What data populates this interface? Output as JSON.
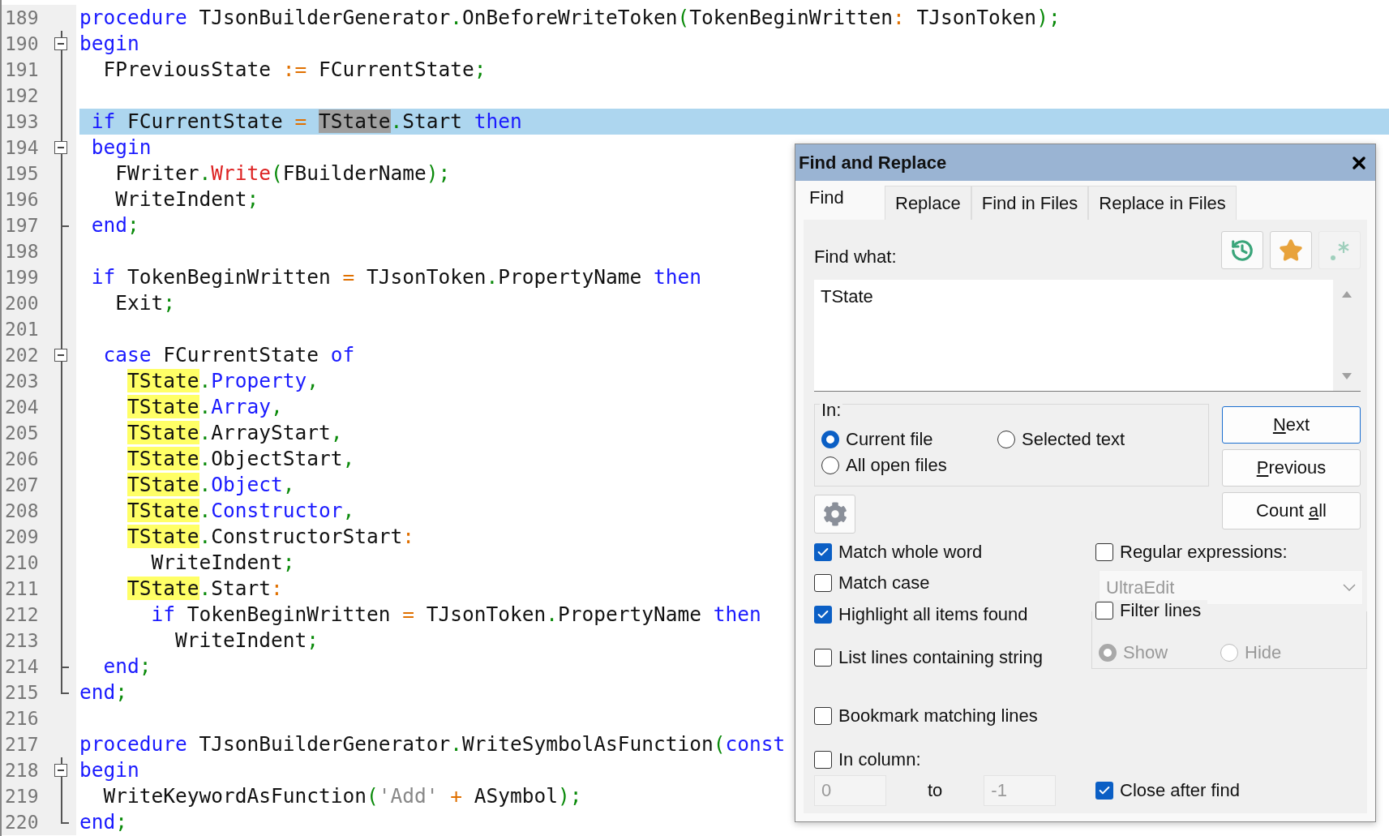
{
  "editor": {
    "lines": [
      {
        "number": "189",
        "kind": "none",
        "current": false,
        "tokens": [
          {
            "kind": "kw",
            "text": "procedure"
          },
          {
            "kind": "id",
            "text": " TJsonBuilderGenerator"
          },
          {
            "kind": "punct",
            "text": "."
          },
          {
            "kind": "id",
            "text": "OnBeforeWriteToken"
          },
          {
            "kind": "punct",
            "text": "("
          },
          {
            "kind": "id",
            "text": "TokenBeginWritten"
          },
          {
            "kind": "op",
            "text": ":"
          },
          {
            "kind": "id",
            "text": " TJsonToken"
          },
          {
            "kind": "punct",
            "text": ");"
          }
        ]
      },
      {
        "number": "190",
        "kind": "collapse",
        "current": false,
        "tokens": [
          {
            "kind": "kw",
            "text": "begin"
          }
        ]
      },
      {
        "number": "191",
        "kind": "line",
        "current": false,
        "tokens": [
          {
            "kind": "id",
            "text": "  FPreviousState "
          },
          {
            "kind": "op",
            "text": ":="
          },
          {
            "kind": "id",
            "text": " FCurrentState"
          },
          {
            "kind": "punct",
            "text": ";"
          }
        ]
      },
      {
        "number": "192",
        "kind": "line",
        "current": false
      },
      {
        "number": "193",
        "kind": "line",
        "current": true,
        "tokens": [
          {
            "kind": "kw",
            "text": " if"
          },
          {
            "kind": "id",
            "text": " FCurrentState "
          },
          {
            "kind": "op",
            "text": "="
          },
          {
            "kind": "selected",
            "text": " TState"
          },
          {
            "kind": "punct",
            "text": "."
          },
          {
            "kind": "id",
            "text": "Start "
          },
          {
            "kind": "kw",
            "text": "then"
          }
        ]
      },
      {
        "number": "194",
        "kind": "collapse",
        "current": false,
        "tokens": [
          {
            "kind": "kw",
            "text": " begin"
          }
        ]
      },
      {
        "number": "195",
        "kind": "line",
        "current": false,
        "tokens": [
          {
            "kind": "id",
            "text": "   FWriter"
          },
          {
            "kind": "punct",
            "text": "."
          },
          {
            "kind": "method",
            "text": "Write"
          },
          {
            "kind": "punct",
            "text": "("
          },
          {
            "kind": "id",
            "text": "FBuilderName"
          },
          {
            "kind": "punct",
            "text": ");"
          }
        ]
      },
      {
        "number": "196",
        "kind": "line",
        "current": false,
        "tokens": [
          {
            "kind": "id",
            "text": "   WriteIndent"
          },
          {
            "kind": "punct",
            "text": ";"
          }
        ]
      },
      {
        "number": "197",
        "kind": "branch",
        "current": false,
        "tokens": [
          {
            "kind": "kw",
            "text": " end"
          },
          {
            "kind": "punct",
            "text": ";"
          }
        ]
      },
      {
        "number": "198",
        "kind": "line",
        "current": false
      },
      {
        "number": "199",
        "kind": "line",
        "current": false,
        "tokens": [
          {
            "kind": "kw",
            "text": " if"
          },
          {
            "kind": "id",
            "text": " TokenBeginWritten "
          },
          {
            "kind": "op",
            "text": "="
          },
          {
            "kind": "id",
            "text": " TJsonToken"
          },
          {
            "kind": "punct",
            "text": "."
          },
          {
            "kind": "id",
            "text": "PropertyName "
          },
          {
            "kind": "kw",
            "text": "then"
          }
        ]
      },
      {
        "number": "200",
        "kind": "line",
        "current": false,
        "tokens": [
          {
            "kind": "id",
            "text": "   Exit"
          },
          {
            "kind": "punct",
            "text": ";"
          }
        ]
      },
      {
        "number": "201",
        "kind": "line",
        "current": false
      },
      {
        "number": "202",
        "kind": "collapse",
        "current": false,
        "tokens": [
          {
            "kind": "kw",
            "text": "  case"
          },
          {
            "kind": "id",
            "text": " FCurrentState "
          },
          {
            "kind": "kw",
            "text": "of"
          }
        ]
      },
      {
        "number": "203",
        "kind": "line",
        "current": false,
        "tokens": [
          {
            "kind": "match",
            "text": "    TState"
          },
          {
            "kind": "punct",
            "text": "."
          },
          {
            "kind": "kw",
            "text": "Property"
          },
          {
            "kind": "punct",
            "text": ","
          }
        ]
      },
      {
        "number": "204",
        "kind": "line",
        "current": false,
        "tokens": [
          {
            "kind": "match",
            "text": "    TState"
          },
          {
            "kind": "punct",
            "text": "."
          },
          {
            "kind": "kw",
            "text": "Array"
          },
          {
            "kind": "punct",
            "text": ","
          }
        ]
      },
      {
        "number": "205",
        "kind": "line",
        "current": false,
        "tokens": [
          {
            "kind": "match",
            "text": "    TState"
          },
          {
            "kind": "punct",
            "text": "."
          },
          {
            "kind": "id",
            "text": "ArrayStart"
          },
          {
            "kind": "punct",
            "text": ","
          }
        ]
      },
      {
        "number": "206",
        "kind": "line",
        "current": false,
        "tokens": [
          {
            "kind": "match",
            "text": "    TState"
          },
          {
            "kind": "punct",
            "text": "."
          },
          {
            "kind": "id",
            "text": "ObjectStart"
          },
          {
            "kind": "punct",
            "text": ","
          }
        ]
      },
      {
        "number": "207",
        "kind": "line",
        "current": false,
        "tokens": [
          {
            "kind": "match",
            "text": "    TState"
          },
          {
            "kind": "punct",
            "text": "."
          },
          {
            "kind": "kw",
            "text": "Object"
          },
          {
            "kind": "punct",
            "text": ","
          }
        ]
      },
      {
        "number": "208",
        "kind": "line",
        "current": false,
        "tokens": [
          {
            "kind": "match",
            "text": "    TState"
          },
          {
            "kind": "punct",
            "text": "."
          },
          {
            "kind": "kw",
            "text": "Constructor"
          },
          {
            "kind": "punct",
            "text": ","
          }
        ]
      },
      {
        "number": "209",
        "kind": "line",
        "current": false,
        "tokens": [
          {
            "kind": "match",
            "text": "    TState"
          },
          {
            "kind": "punct",
            "text": "."
          },
          {
            "kind": "id",
            "text": "ConstructorStart"
          },
          {
            "kind": "op",
            "text": ":"
          }
        ]
      },
      {
        "number": "210",
        "kind": "line",
        "current": false,
        "tokens": [
          {
            "kind": "id",
            "text": "      WriteIndent"
          },
          {
            "kind": "punct",
            "text": ";"
          }
        ]
      },
      {
        "number": "211",
        "kind": "line",
        "current": false,
        "tokens": [
          {
            "kind": "match",
            "text": "    TState"
          },
          {
            "kind": "punct",
            "text": "."
          },
          {
            "kind": "id",
            "text": "Start"
          },
          {
            "kind": "op",
            "text": ":"
          }
        ]
      },
      {
        "number": "212",
        "kind": "line",
        "current": false,
        "tokens": [
          {
            "kind": "kw",
            "text": "      if"
          },
          {
            "kind": "id",
            "text": " TokenBeginWritten "
          },
          {
            "kind": "op",
            "text": "="
          },
          {
            "kind": "id",
            "text": " TJsonToken"
          },
          {
            "kind": "punct",
            "text": "."
          },
          {
            "kind": "id",
            "text": "PropertyName "
          },
          {
            "kind": "kw",
            "text": "then"
          }
        ]
      },
      {
        "number": "213",
        "kind": "line",
        "current": false,
        "tokens": [
          {
            "kind": "id",
            "text": "        WriteIndent"
          },
          {
            "kind": "punct",
            "text": ";"
          }
        ]
      },
      {
        "number": "214",
        "kind": "branch",
        "current": false,
        "tokens": [
          {
            "kind": "kw",
            "text": "  end"
          },
          {
            "kind": "punct",
            "text": ";"
          }
        ]
      },
      {
        "number": "215",
        "kind": "end",
        "current": false,
        "tokens": [
          {
            "kind": "kw",
            "text": "end"
          },
          {
            "kind": "punct",
            "text": ";"
          }
        ]
      },
      {
        "number": "216",
        "kind": "none",
        "current": false
      },
      {
        "number": "217",
        "kind": "none",
        "current": false,
        "tokens": [
          {
            "kind": "kw",
            "text": "procedure"
          },
          {
            "kind": "id",
            "text": " TJsonBuilderGenerator"
          },
          {
            "kind": "punct",
            "text": "."
          },
          {
            "kind": "id",
            "text": "WriteSymbolAsFunction"
          },
          {
            "kind": "punct",
            "text": "("
          },
          {
            "kind": "kw",
            "text": "const"
          }
        ]
      },
      {
        "number": "218",
        "kind": "collapse",
        "current": false,
        "tokens": [
          {
            "kind": "kw",
            "text": "begin"
          }
        ]
      },
      {
        "number": "219",
        "kind": "line",
        "current": false,
        "tokens": [
          {
            "kind": "id",
            "text": "  WriteKeywordAsFunction"
          },
          {
            "kind": "punct",
            "text": "("
          },
          {
            "kind": "string",
            "text": "'Add'"
          },
          {
            "kind": "op",
            "text": " +"
          },
          {
            "kind": "id",
            "text": " ASymbol"
          },
          {
            "kind": "punct",
            "text": ");"
          }
        ]
      },
      {
        "number": "220",
        "kind": "end",
        "current": false,
        "tokens": [
          {
            "kind": "kw",
            "text": "end"
          },
          {
            "kind": "punct",
            "text": ";"
          }
        ]
      }
    ]
  },
  "dialog": {
    "title": "Find and Replace",
    "tabs": [
      {
        "label": "Find",
        "selected": true
      },
      {
        "label": "Replace",
        "selected": false
      },
      {
        "label": "Find in Files",
        "selected": false
      },
      {
        "label": "Replace in Files",
        "selected": false
      }
    ],
    "find_label": "Find what:",
    "find_value": "TState",
    "scope": {
      "label": "In:",
      "options": [
        {
          "label": "Current file",
          "selected": true
        },
        {
          "label": "Selected text",
          "selected": false
        },
        {
          "label": "All open files",
          "selected": false
        }
      ]
    },
    "buttons": [
      {
        "label_parts": [
          {
            "text": "N",
            "underlined": true
          },
          {
            "text": "ext",
            "underlined": false
          }
        ],
        "default": true
      },
      {
        "label_parts": [
          {
            "text": "P",
            "underlined": true
          },
          {
            "text": "revious",
            "underlined": false
          }
        ],
        "default": false
      },
      {
        "label_parts": [
          {
            "text": "Count ",
            "underlined": false
          },
          {
            "text": "a",
            "underlined": true
          },
          {
            "text": "ll",
            "underlined": false
          }
        ],
        "default": false
      }
    ],
    "options": [
      {
        "label": "Match whole word",
        "checked": true
      },
      {
        "label": "Match case",
        "checked": false
      },
      {
        "label": "Highlight all items found",
        "checked": true
      },
      {
        "label": "List lines containing string",
        "checked": false
      },
      {
        "label": "Bookmark matching lines",
        "checked": false
      }
    ],
    "regex": {
      "label": "Regular expressions:",
      "checked": false,
      "engine": "UltraEdit"
    },
    "filter": {
      "label": "Filter lines",
      "checked": false,
      "options": [
        {
          "label": "Show",
          "selected": true
        },
        {
          "label": "Hide",
          "selected": false
        }
      ]
    },
    "column": {
      "label": "In column:",
      "checked": false,
      "from": "0",
      "to_label": "to",
      "to": "-1"
    },
    "close_after_find": {
      "label": "Close after find",
      "checked": true
    }
  }
}
